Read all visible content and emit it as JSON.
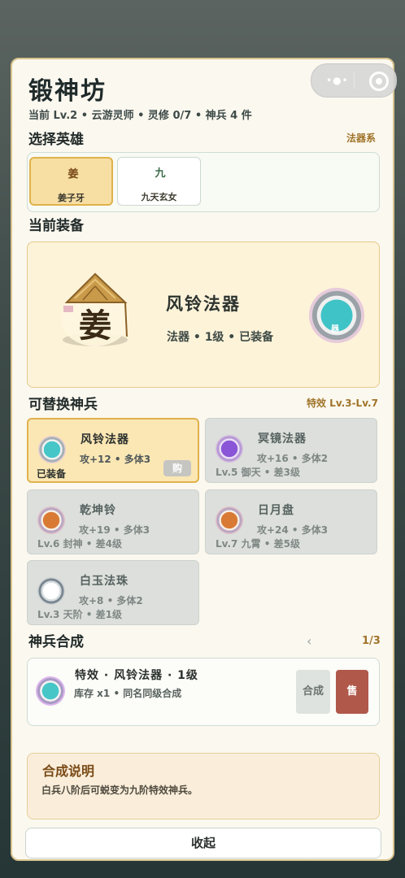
{
  "header": {
    "title": "锻神坊",
    "subtitle": "当前 Lv.2 • 云游灵师 • 灵修 0/7 • 神兵 4 件",
    "menu_dots": "•●•"
  },
  "hero_section": {
    "title": "选择英雄",
    "tag": "法器系",
    "heroes": [
      {
        "icon_char": "姜",
        "name": "姜子牙",
        "selected": true
      },
      {
        "icon_char": "九",
        "name": "九天玄女",
        "selected": false
      }
    ]
  },
  "equip_section": {
    "title": "当前装备",
    "portrait_char": "姜",
    "item_name": "风铃法器",
    "item_meta": "法器 • 1级 • 已装备",
    "orb_char": "器"
  },
  "replace_section": {
    "title": "可替换神兵",
    "tag": "特效 Lv.3-Lv.7",
    "cards": [
      {
        "name": "风铃法器",
        "stats": "攻+12 • 多体3",
        "bottom": "已装备",
        "buy_label": "购",
        "orb": "teal",
        "active": true
      },
      {
        "name": "冥镜法器",
        "stats": "攻+16 • 多体2",
        "bottom": "Lv.5 御天 • 差3级",
        "orb": "purple",
        "active": false
      },
      {
        "name": "乾坤铃",
        "stats": "攻+19 • 多体3",
        "bottom": "Lv.6 封神 • 差4级",
        "orb": "orange",
        "active": false
      },
      {
        "name": "日月盘",
        "stats": "攻+24 • 多体3",
        "bottom": "Lv.7 九霄 • 差5级",
        "orb": "orange",
        "active": false
      },
      {
        "name": "白玉法珠",
        "stats": "攻+8 • 多体2",
        "bottom": "Lv.3 天阶 • 差1级",
        "orb": "white",
        "active": false
      }
    ]
  },
  "synth_section": {
    "title": "神兵合成",
    "prev_arrow": "‹",
    "page": "1/3",
    "item_title": "特效 · 风铃法器 · 1级",
    "item_sub": "库存 x1 • 同名同级合成",
    "synth_label": "合成",
    "sell_label": "售"
  },
  "note": {
    "title": "合成说明",
    "text": "白兵八阶后可蜕变为九阶特效神兵。"
  },
  "close_label": "收起",
  "colors": {
    "accent_gold": "#e0b24a",
    "sell_red": "#b0584a",
    "tag_brown": "#a0742a"
  }
}
